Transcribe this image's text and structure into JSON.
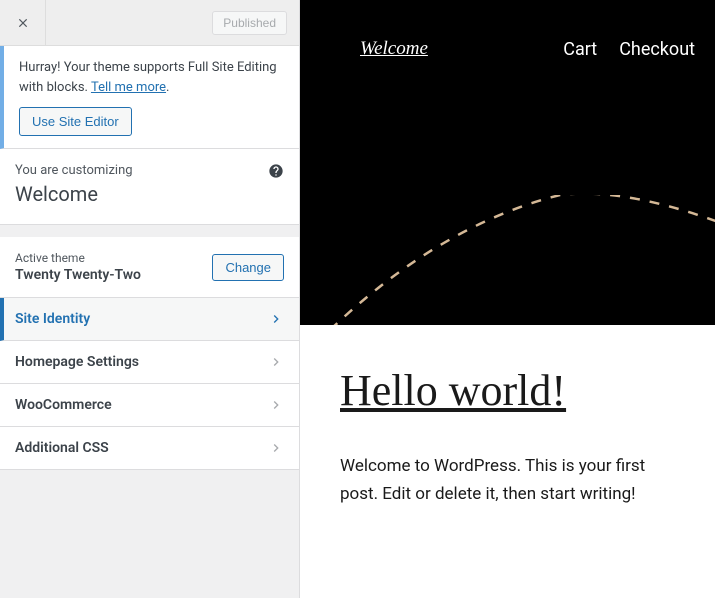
{
  "topbar": {
    "published_label": "Published"
  },
  "notice": {
    "text_before": "Hurray! Your theme supports Full Site Editing with blocks. ",
    "link": "Tell me more",
    "period": ".",
    "button": "Use Site Editor"
  },
  "customizing": {
    "label": "You are customizing",
    "title": "Welcome"
  },
  "theme": {
    "label": "Active theme",
    "name": "Twenty Twenty-Two",
    "change": "Change"
  },
  "nav": {
    "items": [
      {
        "label": "Site Identity",
        "active": true
      },
      {
        "label": "Homepage Settings",
        "active": false
      },
      {
        "label": "WooCommerce",
        "active": false
      },
      {
        "label": "Additional CSS",
        "active": false
      }
    ]
  },
  "preview": {
    "site_title": "Welcome",
    "links": [
      "Cart",
      "Checkout"
    ],
    "post_title": "Hello world!",
    "post_body": "Welcome to WordPress. This is your first post. Edit or delete it, then start writing!"
  }
}
